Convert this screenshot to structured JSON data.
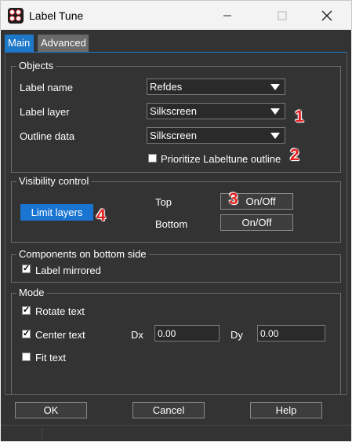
{
  "window": {
    "title": "Label Tune",
    "minimize_icon": "minimize-icon",
    "maximize_icon": "maximize-icon",
    "close_icon": "close-icon"
  },
  "tabs": [
    {
      "label": "Main",
      "active": true
    },
    {
      "label": "Advanced",
      "active": false
    }
  ],
  "objects": {
    "title": "Objects",
    "label_name": {
      "label": "Label name",
      "value": "Refdes"
    },
    "label_layer": {
      "label": "Label layer",
      "value": "Silkscreen"
    },
    "outline_data": {
      "label": "Outline data",
      "value": "Silkscreen"
    },
    "prioritize": {
      "label": "Prioritize Labeltune outline",
      "checked": false
    }
  },
  "visibility": {
    "title": "Visibility control",
    "limit_layers": "Limit layers",
    "top_label": "Top",
    "top_button": "On/Off",
    "bottom_label": "Bottom",
    "bottom_button": "On/Off"
  },
  "bottom_side": {
    "title": "Components on bottom side",
    "label_mirrored": {
      "label": "Label mirrored",
      "checked": true
    }
  },
  "mode": {
    "title": "Mode",
    "rotate_text": {
      "label": "Rotate text",
      "checked": true
    },
    "center_text": {
      "label": "Center text",
      "checked": true
    },
    "dx_label": "Dx",
    "dx_value": "0.00",
    "dy_label": "Dy",
    "dy_value": "0.00",
    "fit_text": {
      "label": "Fit text",
      "checked": false
    }
  },
  "footer": {
    "ok": "OK",
    "cancel": "Cancel",
    "help": "Help"
  },
  "annotations": [
    "1",
    "2",
    "3",
    "4"
  ],
  "colors": {
    "background": "#333333",
    "accent": "#1e78c8",
    "annotation": "#e62020"
  }
}
